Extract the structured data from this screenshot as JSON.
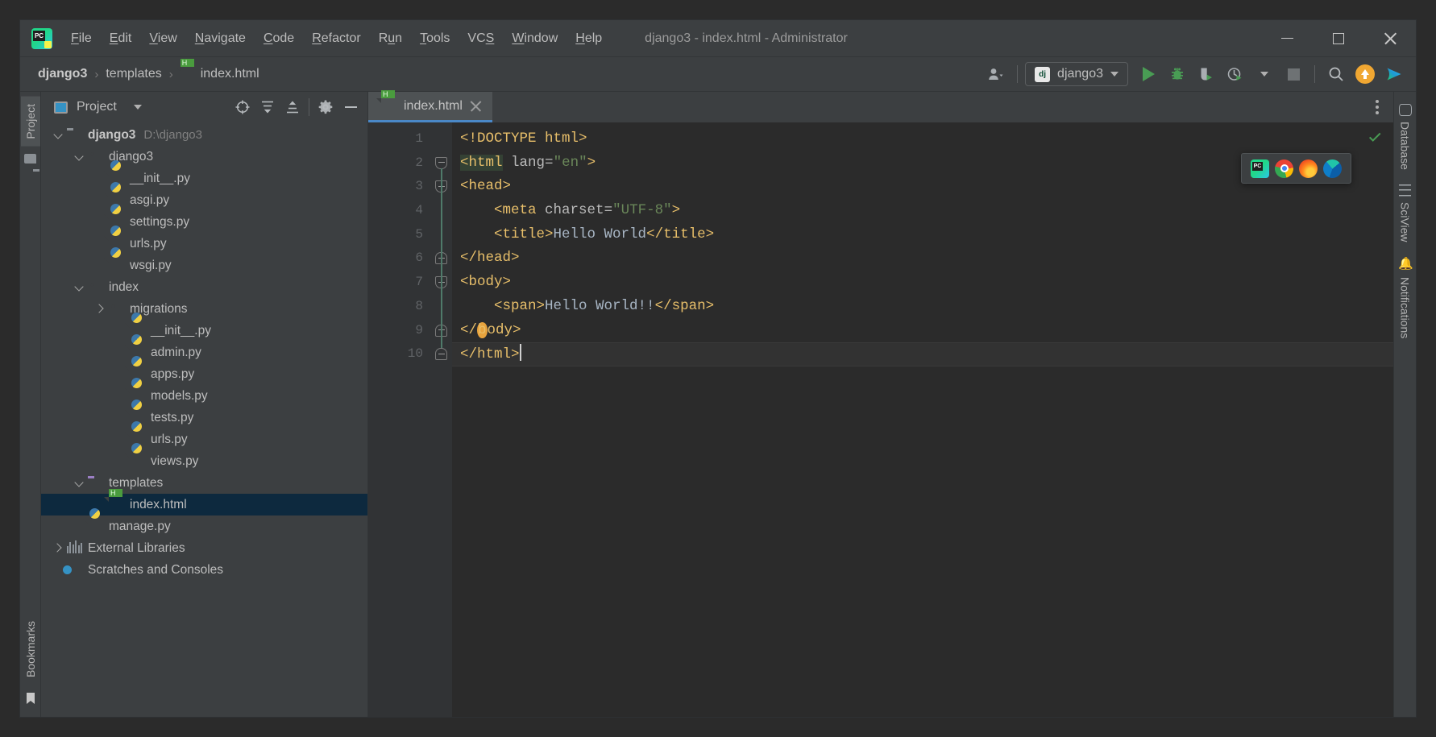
{
  "window": {
    "title": "django3 - index.html - Administrator",
    "logo_icon": "pycharm-logo-icon",
    "controls": {
      "minimize": "minimize-icon",
      "maximize": "maximize-icon",
      "close": "close-icon"
    }
  },
  "menu": [
    {
      "label": "File",
      "mnemonic": "F"
    },
    {
      "label": "Edit",
      "mnemonic": "E"
    },
    {
      "label": "View",
      "mnemonic": "V"
    },
    {
      "label": "Navigate",
      "mnemonic": "N"
    },
    {
      "label": "Code",
      "mnemonic": "C"
    },
    {
      "label": "Refactor",
      "mnemonic": "R"
    },
    {
      "label": "Run",
      "mnemonic": "u"
    },
    {
      "label": "Tools",
      "mnemonic": "T"
    },
    {
      "label": "VCS",
      "mnemonic": "S"
    },
    {
      "label": "Window",
      "mnemonic": "W"
    },
    {
      "label": "Help",
      "mnemonic": "H"
    }
  ],
  "navbar": {
    "breadcrumbs": [
      {
        "label": "django3",
        "icon": ""
      },
      {
        "label": "templates",
        "icon": ""
      },
      {
        "label": "index.html",
        "icon": "html-file-icon"
      }
    ],
    "separator": "›",
    "run_config": {
      "label": "django3",
      "icon": "django-icon"
    },
    "toolbar_buttons": [
      {
        "name": "user-account-button",
        "icon": "user-icon"
      },
      {
        "name": "run-button",
        "icon": "run-triangle-icon"
      },
      {
        "name": "debug-button",
        "icon": "bug-icon"
      },
      {
        "name": "run-coverage-button",
        "icon": "coverage-shield-icon"
      },
      {
        "name": "profile-button",
        "icon": "clock-profile-icon"
      },
      {
        "name": "stop-button",
        "icon": "stop-square-icon"
      },
      {
        "name": "search-everywhere-button",
        "icon": "search-icon"
      },
      {
        "name": "update-project-button",
        "icon": "update-arrow-icon"
      },
      {
        "name": "share-button",
        "icon": "gradient-play-icon"
      }
    ]
  },
  "left_strip": {
    "top_tab": "Project",
    "bottom_tab": "Bookmarks",
    "bottom_icon": "bookmark-icon"
  },
  "right_strip": {
    "tabs": [
      {
        "label": "Database",
        "icon": "database-icon"
      },
      {
        "label": "SciView",
        "icon": "grid-icon"
      },
      {
        "label": "Notifications",
        "icon": "bell-icon"
      }
    ]
  },
  "project_panel": {
    "title": "Project",
    "title_icon": "project-window-icon",
    "actions": [
      {
        "name": "select-opened-file-button",
        "icon": "locate-target-icon"
      },
      {
        "name": "expand-all-button",
        "icon": "expand-all-icon"
      },
      {
        "name": "collapse-all-button",
        "icon": "collapse-all-icon"
      },
      {
        "name": "settings-button",
        "icon": "gear-icon"
      },
      {
        "name": "hide-button",
        "icon": "minimize-icon"
      }
    ],
    "tree": [
      {
        "label": "django3",
        "suffix": "D:\\django3",
        "icon": "folder-icon",
        "indent": 0,
        "state": "expanded",
        "bold": true,
        "selected": false
      },
      {
        "label": "django3",
        "suffix": "",
        "icon": "module-folder-icon",
        "indent": 1,
        "state": "expanded",
        "bold": false,
        "selected": false
      },
      {
        "label": "__init__.py",
        "suffix": "",
        "icon": "python-file-icon",
        "indent": 2,
        "state": "leaf",
        "bold": false,
        "selected": false
      },
      {
        "label": "asgi.py",
        "suffix": "",
        "icon": "python-file-icon",
        "indent": 2,
        "state": "leaf",
        "bold": false,
        "selected": false
      },
      {
        "label": "settings.py",
        "suffix": "",
        "icon": "python-file-icon",
        "indent": 2,
        "state": "leaf",
        "bold": false,
        "selected": false
      },
      {
        "label": "urls.py",
        "suffix": "",
        "icon": "python-file-icon",
        "indent": 2,
        "state": "leaf",
        "bold": false,
        "selected": false
      },
      {
        "label": "wsgi.py",
        "suffix": "",
        "icon": "python-file-icon",
        "indent": 2,
        "state": "leaf",
        "bold": false,
        "selected": false
      },
      {
        "label": "index",
        "suffix": "",
        "icon": "module-folder-icon",
        "indent": 1,
        "state": "expanded",
        "bold": false,
        "selected": false
      },
      {
        "label": "migrations",
        "suffix": "",
        "icon": "module-folder-icon",
        "indent": 2,
        "state": "collapsed",
        "bold": false,
        "selected": false
      },
      {
        "label": "__init__.py",
        "suffix": "",
        "icon": "python-file-icon",
        "indent": 3,
        "state": "leaf",
        "bold": false,
        "selected": false
      },
      {
        "label": "admin.py",
        "suffix": "",
        "icon": "python-file-icon",
        "indent": 3,
        "state": "leaf",
        "bold": false,
        "selected": false
      },
      {
        "label": "apps.py",
        "suffix": "",
        "icon": "python-file-icon",
        "indent": 3,
        "state": "leaf",
        "bold": false,
        "selected": false
      },
      {
        "label": "models.py",
        "suffix": "",
        "icon": "python-file-icon",
        "indent": 3,
        "state": "leaf",
        "bold": false,
        "selected": false
      },
      {
        "label": "tests.py",
        "suffix": "",
        "icon": "python-file-icon",
        "indent": 3,
        "state": "leaf",
        "bold": false,
        "selected": false
      },
      {
        "label": "urls.py",
        "suffix": "",
        "icon": "python-file-icon",
        "indent": 3,
        "state": "leaf",
        "bold": false,
        "selected": false
      },
      {
        "label": "views.py",
        "suffix": "",
        "icon": "python-file-icon",
        "indent": 3,
        "state": "leaf",
        "bold": false,
        "selected": false
      },
      {
        "label": "templates",
        "suffix": "",
        "icon": "templates-folder-icon",
        "indent": 1,
        "state": "expanded",
        "bold": false,
        "selected": false
      },
      {
        "label": "index.html",
        "suffix": "",
        "icon": "html-file-icon",
        "indent": 2,
        "state": "leaf",
        "bold": false,
        "selected": true
      },
      {
        "label": "manage.py",
        "suffix": "",
        "icon": "python-file-icon",
        "indent": 1,
        "state": "leaf",
        "bold": false,
        "selected": false
      },
      {
        "label": "External Libraries",
        "suffix": "",
        "icon": "libraries-icon",
        "indent": 0,
        "state": "collapsed",
        "bold": false,
        "selected": false
      },
      {
        "label": "Scratches and Consoles",
        "suffix": "",
        "icon": "scratches-icon",
        "indent": 0,
        "state": "leaf",
        "bold": false,
        "selected": false
      }
    ]
  },
  "editor": {
    "tabs": [
      {
        "label": "index.html",
        "icon": "html-file-icon",
        "active": true,
        "close_icon": "close-icon"
      }
    ],
    "options_icon": "kebab-menu-icon",
    "inspection_status_icon": "check-ok-icon",
    "current_line": 10,
    "lines": [
      {
        "n": 1,
        "fold": "",
        "indent": 0,
        "tokens": [
          {
            "t": "doctype",
            "v": "<!DOCTYPE html>"
          }
        ]
      },
      {
        "n": 2,
        "fold": "start",
        "indent": 0,
        "tokens": [
          {
            "t": "tag",
            "v": "<html",
            "hl": "match"
          },
          {
            "t": "plain",
            "v": " "
          },
          {
            "t": "attr",
            "v": "lang"
          },
          {
            "t": "plain",
            "v": "="
          },
          {
            "t": "val",
            "v": "\"en\""
          },
          {
            "t": "tag",
            "v": ">"
          }
        ]
      },
      {
        "n": 3,
        "fold": "start",
        "indent": 0,
        "tokens": [
          {
            "t": "tag",
            "v": "<head>"
          }
        ]
      },
      {
        "n": 4,
        "fold": "",
        "indent": 1,
        "tokens": [
          {
            "t": "tag",
            "v": "<meta"
          },
          {
            "t": "plain",
            "v": " "
          },
          {
            "t": "attr",
            "v": "charset"
          },
          {
            "t": "plain",
            "v": "="
          },
          {
            "t": "val",
            "v": "\"UTF-8\""
          },
          {
            "t": "tag",
            "v": ">"
          }
        ]
      },
      {
        "n": 5,
        "fold": "",
        "indent": 1,
        "tokens": [
          {
            "t": "tag",
            "v": "<title>"
          },
          {
            "t": "text",
            "v": "Hello World"
          },
          {
            "t": "tag",
            "v": "</title>"
          }
        ]
      },
      {
        "n": 6,
        "fold": "end",
        "indent": 0,
        "tokens": [
          {
            "t": "tag",
            "v": "</head>"
          }
        ]
      },
      {
        "n": 7,
        "fold": "start",
        "indent": 0,
        "tokens": [
          {
            "t": "tag",
            "v": "<body>"
          }
        ]
      },
      {
        "n": 8,
        "fold": "",
        "indent": 1,
        "tokens": [
          {
            "t": "tag",
            "v": "<span>"
          },
          {
            "t": "text",
            "v": "Hello World!!"
          },
          {
            "t": "tag",
            "v": "</span>"
          }
        ]
      },
      {
        "n": 9,
        "fold": "end",
        "indent": 0,
        "tokens": [
          {
            "t": "tag",
            "v": "</"
          },
          {
            "t": "tag",
            "v": "b",
            "hl": "warn"
          },
          {
            "t": "tag",
            "v": "ody>"
          }
        ]
      },
      {
        "n": 10,
        "fold": "end",
        "indent": 0,
        "tokens": [
          {
            "t": "tag",
            "v": "</html>"
          },
          {
            "t": "caret",
            "v": ""
          }
        ]
      }
    ],
    "run_line_icon": "python-run-icon"
  },
  "browser_popup": {
    "items": [
      {
        "name": "open-in-pycharm-builtin-preview",
        "icon": "pycharm-icon"
      },
      {
        "name": "open-in-chrome",
        "icon": "chrome-icon"
      },
      {
        "name": "open-in-firefox",
        "icon": "firefox-icon"
      },
      {
        "name": "open-in-edge",
        "icon": "edge-icon"
      }
    ]
  },
  "colors": {
    "bg_ide": "#3c3f41",
    "bg_editor": "#2b2b2b",
    "bg_gutter": "#313335",
    "accent_tab": "#4a88c7",
    "selection": "#0d293e",
    "tag": "#e8bf6a",
    "attr_value": "#6a8759",
    "text_content": "#a9b7c6",
    "run_green": "#499c54",
    "update_orange": "#f0a732"
  }
}
